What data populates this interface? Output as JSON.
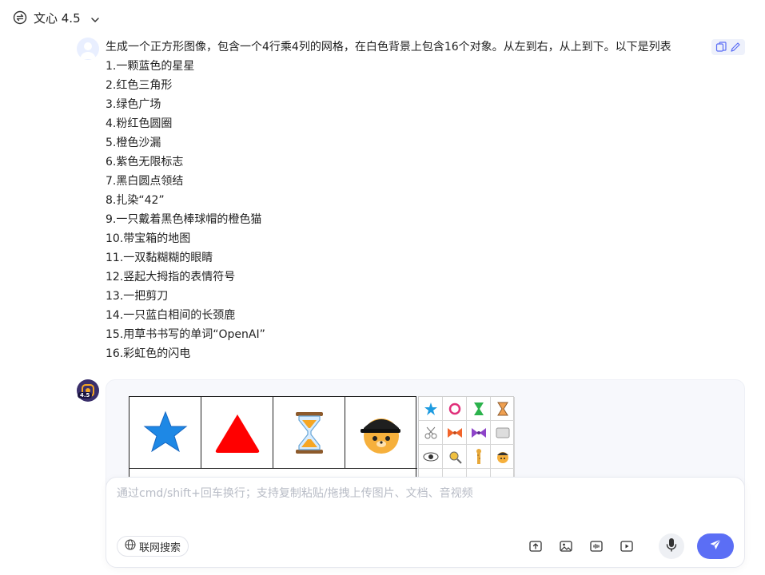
{
  "header": {
    "model_name": "文心 4.5",
    "model_icon": "model-switch-icon"
  },
  "user_message": {
    "first_line": "生成一个正方形图像，包含一个4行乘4列的网格，在白色背景上包含16个对象。从左到右，从上到下。以下是列表",
    "items": [
      "1.一颗蓝色的星星",
      "2.红色三角形",
      "3.绿色广场",
      "4.粉红色圆圈",
      "5.橙色沙漏",
      "6.紫色无限标志",
      "7.黑白圆点领结",
      "8.扎染“42”",
      "9.一只戴着黑色棒球帽的橙色猫",
      "10.带宝箱的地图",
      "11.一双黏糊糊的眼睛",
      "12.竖起大拇指的表情符号",
      "13.一把剪刀",
      "14.一只蓝白相间的长颈鹿",
      "15.用草书书写的单词“OpenAI”",
      "16.彩虹色的闪电"
    ]
  },
  "bot": {
    "avatar_version": "4.5"
  },
  "big_grid": [
    "★",
    "▲",
    "⌛",
    "🐱"
  ],
  "small_grid": [
    "★",
    "○",
    "⧗",
    "⧗",
    "✂",
    "⋈",
    "⋈",
    "▦",
    "◉",
    "◎",
    "🦒",
    "😀",
    "",
    "",
    "",
    ""
  ],
  "composer": {
    "placeholder": "通过cmd/shift+回车换行；支持复制粘贴/拖拽上传图片、文档、音视频",
    "web_search_label": "联网搜索"
  },
  "colors": {
    "accent": "#5b6ef5",
    "star": "#1e88e5",
    "triangle": "#ff0000"
  }
}
